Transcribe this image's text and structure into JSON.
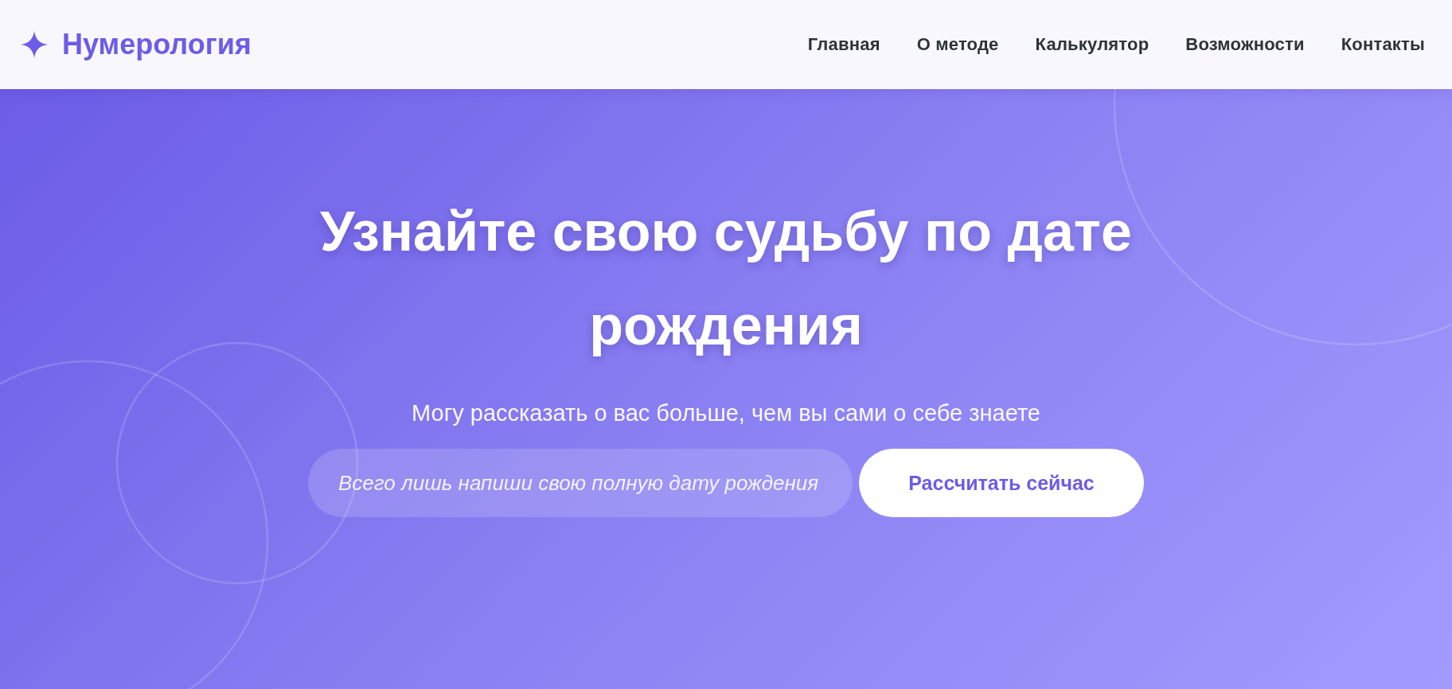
{
  "header": {
    "logo": {
      "text": "Нумерология"
    },
    "nav": [
      {
        "label": "Главная"
      },
      {
        "label": "О методе"
      },
      {
        "label": "Калькулятор"
      },
      {
        "label": "Возможности"
      },
      {
        "label": "Контакты"
      }
    ]
  },
  "hero": {
    "title": "Узнайте свою судьбу по дате рождения",
    "subtitle": "Могу рассказать о вас больше, чем вы сами о себе знаете",
    "date_field": {
      "placeholder": "Всего лишь напиши свою полную дату рождения"
    },
    "submit_button": {
      "label": "Рассчитать сейчас"
    }
  }
}
